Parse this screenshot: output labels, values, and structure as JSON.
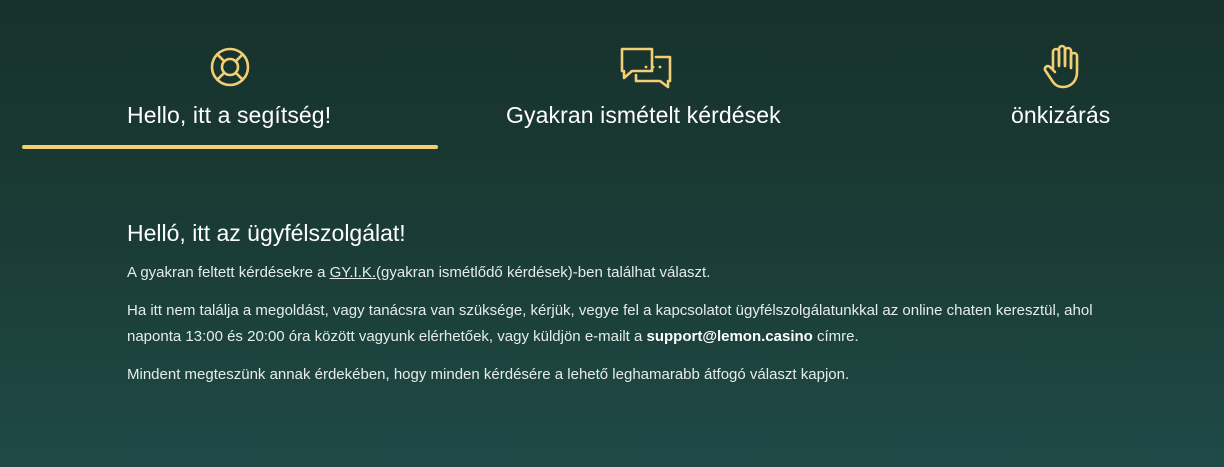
{
  "colors": {
    "accent": "#f2cf75",
    "background_top": "#17312b",
    "background_bottom": "#1f4a47",
    "text": "#ffffff"
  },
  "tabs": [
    {
      "label": "Hello, itt a segítség!",
      "icon": "lifebuoy-icon",
      "active": true
    },
    {
      "label": "Gyakran ismételt kérdések",
      "icon": "chat-bubbles-icon",
      "active": false
    },
    {
      "label": "önkizárás",
      "icon": "hand-icon",
      "active": false
    }
  ],
  "content": {
    "title": "Helló, itt az ügyfélszolgálat!",
    "p1_before": "A gyakran feltett kérdésekre a ",
    "p1_link": "GY.I.K.",
    "p1_after": "(gyakran ismétlődő kérdések)-ben találhat választ.",
    "p2_before": "Ha itt nem találja a megoldást, vagy tanácsra van szüksége, kérjük, vegye fel a kapcsolatot ügyfélszolgálatunkkal az online chaten keresztül, ahol naponta 13:00 és 20:00 óra között vagyunk elérhetőek, vagy küldjön e-mailt a ",
    "p2_email": "support@lemon.casino",
    "p2_after": " címre.",
    "p3": "Mindent megteszünk annak érdekében, hogy minden kérdésére a lehető leghamarabb átfogó választ kapjon."
  }
}
